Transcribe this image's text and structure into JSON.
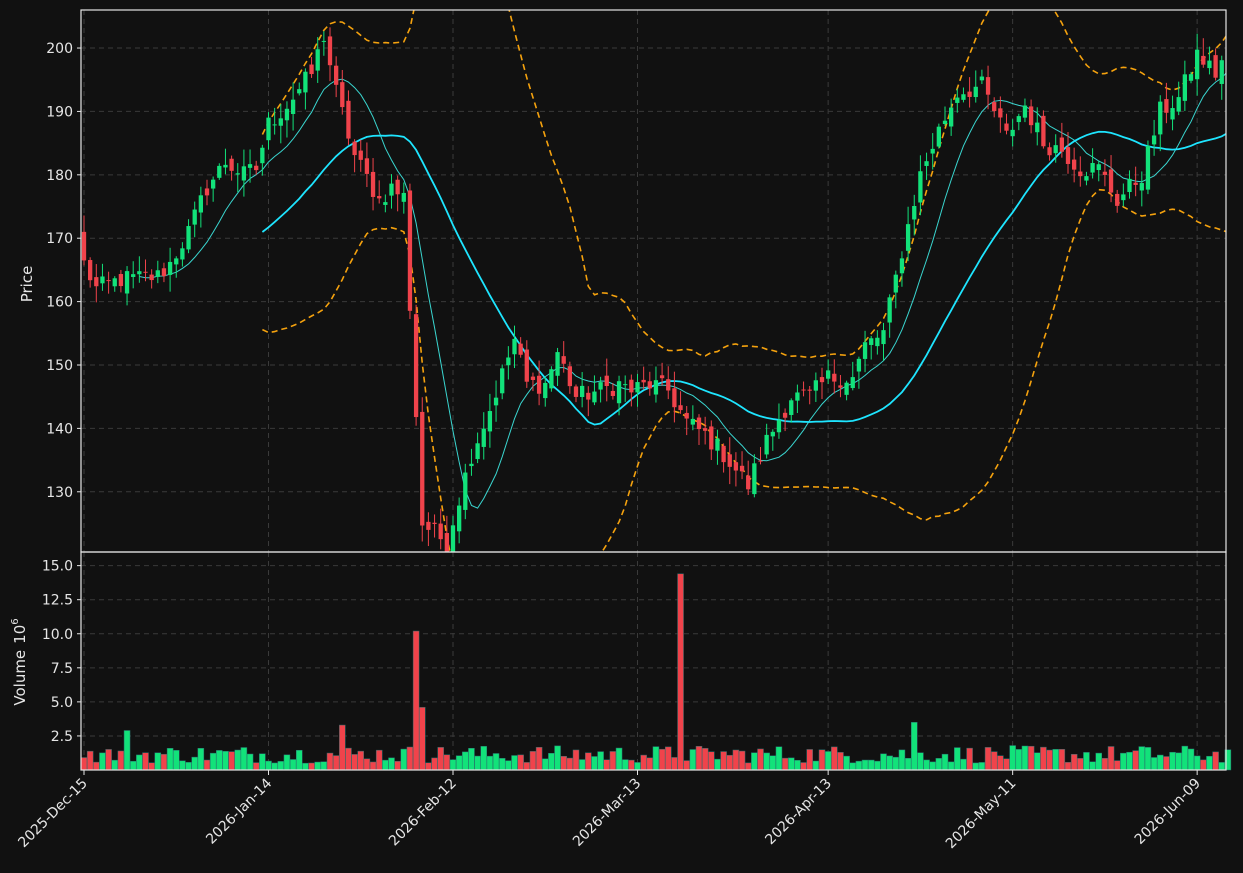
{
  "chart_data": {
    "type": "candlestick",
    "title": "",
    "x_tick_labels": [
      "2025-Dec-15",
      "2026-Jan-14",
      "2026-Feb-12",
      "2026-Mar-13",
      "2026-Apr-13",
      "2026-May-11",
      "2026-Jun-09"
    ],
    "x_tick_indices": [
      0,
      30,
      60,
      90,
      121,
      151,
      181
    ],
    "price_panel": {
      "ylabel": "Price",
      "ylim": [
        120.5,
        206
      ],
      "yticks": [
        130,
        140,
        150,
        160,
        170,
        180,
        190,
        200
      ],
      "grid": true
    },
    "volume_panel": {
      "ylabel": "Volume",
      "ylabel_exponent": "6",
      "ylim": [
        0,
        16.0
      ],
      "yticks": [
        "2.5",
        "5.0",
        "7.5",
        "10.0",
        "12.5",
        "15.0"
      ],
      "grid": true
    },
    "colors": {
      "background": "#111111",
      "up": "#12e27a",
      "down": "#f0434b",
      "ma_short": "#3ad6d0",
      "ma_long": "#1ee5ff",
      "bollinger": "#f5a20e",
      "text": "#e6e6e6",
      "grid": "#3a3a3a"
    },
    "moving_averages": [
      {
        "window": 10,
        "color": "#3ad6d0"
      },
      {
        "window": 30,
        "color": "#1ee5ff"
      }
    ],
    "bollinger_bands": {
      "window": 30,
      "std": 2,
      "color": "#f5a20e",
      "style": "dashed"
    },
    "close_anchors": [
      [
        0,
        166
      ],
      [
        2,
        162
      ],
      [
        6,
        163.5
      ],
      [
        12,
        164
      ],
      [
        14,
        166
      ],
      [
        17,
        171
      ],
      [
        20,
        178
      ],
      [
        23,
        182
      ],
      [
        26,
        180
      ],
      [
        28,
        181
      ],
      [
        30,
        188
      ],
      [
        33,
        191
      ],
      [
        37,
        196
      ],
      [
        39,
        202
      ],
      [
        41,
        193
      ],
      [
        44,
        183
      ],
      [
        48,
        176
      ],
      [
        50,
        178
      ],
      [
        52,
        176.5
      ],
      [
        55,
        125
      ],
      [
        59,
        122
      ],
      [
        63,
        136
      ],
      [
        66,
        143
      ],
      [
        70,
        154
      ],
      [
        72,
        147
      ],
      [
        75,
        147
      ],
      [
        77,
        152
      ],
      [
        80,
        145
      ],
      [
        84,
        146
      ],
      [
        87,
        147
      ],
      [
        89,
        146
      ],
      [
        92,
        147
      ],
      [
        95,
        146
      ],
      [
        98,
        141
      ],
      [
        101,
        139
      ],
      [
        104,
        136
      ],
      [
        108,
        131
      ],
      [
        111,
        138
      ],
      [
        115,
        145
      ],
      [
        118,
        145
      ],
      [
        121,
        148
      ],
      [
        125,
        148
      ],
      [
        127,
        153
      ],
      [
        130,
        155
      ],
      [
        133,
        168
      ],
      [
        136,
        180
      ],
      [
        139,
        187
      ],
      [
        142,
        193
      ],
      [
        146,
        194
      ],
      [
        150,
        186
      ],
      [
        153,
        191
      ],
      [
        156,
        185
      ],
      [
        159,
        184
      ],
      [
        162,
        181
      ],
      [
        165,
        181
      ],
      [
        168,
        176
      ],
      [
        172,
        180
      ],
      [
        175,
        190
      ],
      [
        178,
        192
      ],
      [
        181,
        199
      ],
      [
        184,
        196
      ],
      [
        186,
        200
      ]
    ],
    "volume_spikes": [
      [
        54,
        10.2
      ],
      [
        55,
        4.6
      ],
      [
        97,
        14.4
      ],
      [
        135,
        3.5
      ],
      [
        42,
        3.3
      ],
      [
        7,
        2.9
      ]
    ],
    "candle_count": 187
  }
}
